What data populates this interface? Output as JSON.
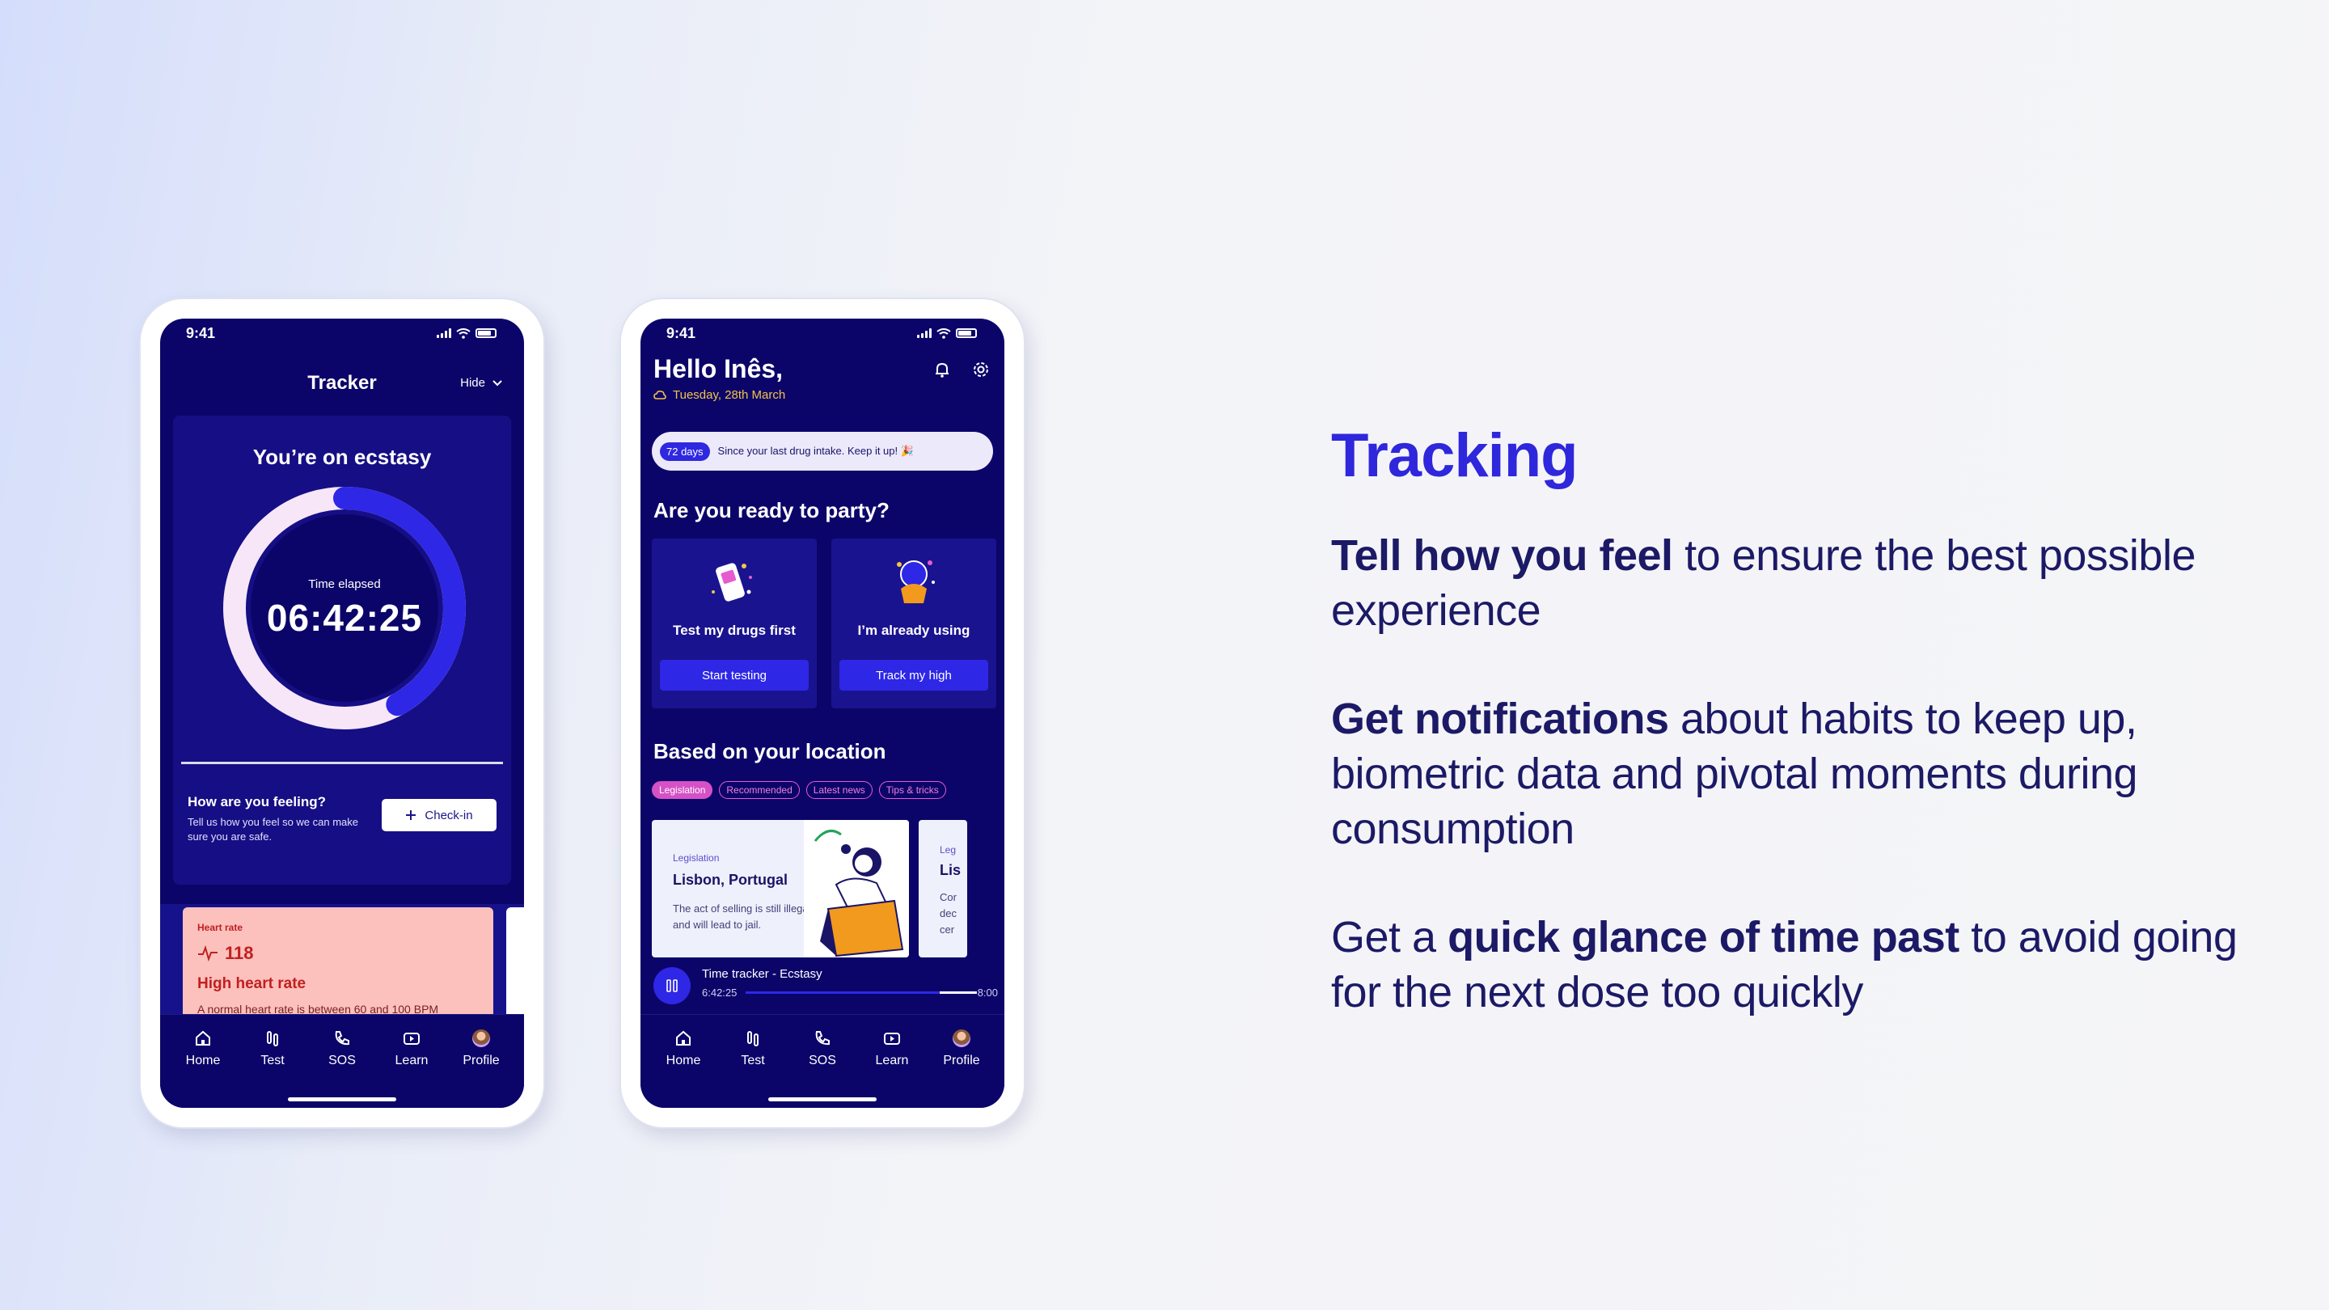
{
  "colors": {
    "accent": "#2f27dc",
    "phone_bg": "#0c0569",
    "text_dark": "#1c1a66",
    "alert": "#c02020"
  },
  "status_bar": {
    "time": "9:41"
  },
  "tabbar": {
    "items": [
      {
        "label": "Home",
        "icon": "home-icon"
      },
      {
        "label": "Test",
        "icon": "test-icon"
      },
      {
        "label": "SOS",
        "icon": "phone-icon"
      },
      {
        "label": "Learn",
        "icon": "play-icon"
      },
      {
        "label": "Profile",
        "icon": "avatar"
      }
    ]
  },
  "tracker": {
    "header": "Tracker",
    "hide_label": "Hide",
    "title": "You’re on ecstasy",
    "time_label": "Time elapsed",
    "time_value": "06:42:25",
    "progress_fraction": 0.42,
    "feeling_title": "How are you feeling?",
    "feeling_desc": "Tell us how you feel so we can make sure you are safe.",
    "checkin_label": "Check-in",
    "heart": {
      "title": "Heart rate",
      "value": "118",
      "status": "High heart rate",
      "description": "A normal heart rate is between 60 and 100 BPM"
    }
  },
  "home": {
    "greeting": "Hello Inês,",
    "date": "Tuesday, 28th March",
    "streak_days": "72 days",
    "streak_text": "Since your last drug intake. Keep it up! 🎉",
    "party_title": "Are you ready to party?",
    "cards": [
      {
        "label": "Test my drugs first",
        "button": "Start testing"
      },
      {
        "label": "I’m already using",
        "button": "Track my high"
      }
    ],
    "location_title": "Based on your location",
    "chips": [
      "Legislation",
      "Recommended",
      "Latest news",
      "Tips & tricks"
    ],
    "info": {
      "tag": "Legislation",
      "title": "Lisbon, Portugal",
      "desc": "The act of selling is still illegal and will lead to jail."
    },
    "info_next": {
      "tag": "Leg",
      "title": "Lis",
      "desc": "Cor\ndec\ncer"
    },
    "player": {
      "title": "Time tracker - Ecstasy",
      "elapsed": "6:42:25",
      "end": "8:00",
      "progress_fraction": 0.84
    }
  },
  "copy": {
    "heading": "Tracking",
    "p1_bold": "Tell how you feel",
    "p1_rest": " to ensure the best possible experience",
    "p2_bold": "Get notifications",
    "p2_rest": " about habits to keep up, biometric data and pivotal moments during consumption",
    "p3_pre": "Get a ",
    "p3_bold": "quick glance of time past",
    "p3_rest": " to avoid going for the next dose too quickly"
  }
}
